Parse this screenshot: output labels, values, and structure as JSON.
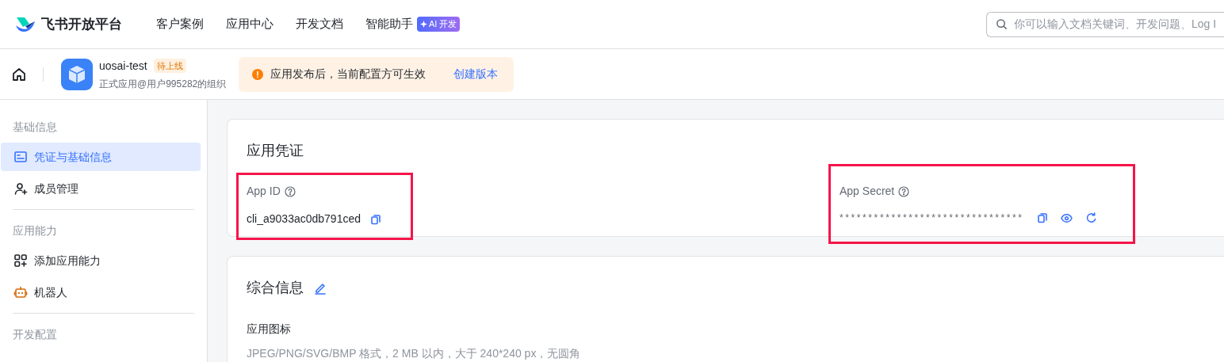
{
  "top_nav": {
    "logo_text": "飞书开放平台",
    "links": [
      {
        "label": "客户案例"
      },
      {
        "label": "应用中心"
      },
      {
        "label": "开发文档"
      },
      {
        "label": "智能助手",
        "badge": "AI 开发"
      }
    ],
    "search": {
      "placeholder": "你可以输入文档关键词、开发问题、Log I"
    }
  },
  "app_bar": {
    "name": "uosai-test",
    "status": "待上线",
    "subtitle": "正式应用@用户995282的组织",
    "notice": {
      "text": "应用发布后，当前配置方可生效",
      "action": "创建版本"
    }
  },
  "sidebar": {
    "groups": [
      {
        "title": "基础信息",
        "items": [
          {
            "label": "凭证与基础信息",
            "selected": true
          },
          {
            "label": "成员管理",
            "selected": false
          }
        ]
      },
      {
        "title": "应用能力",
        "items": [
          {
            "label": "添加应用能力",
            "selected": false
          },
          {
            "label": "机器人",
            "selected": false
          }
        ]
      },
      {
        "title": "开发配置"
      }
    ]
  },
  "credentials": {
    "title": "应用凭证",
    "app_id": {
      "label": "App ID",
      "value": "cli_a9033ac0db791ced"
    },
    "app_secret": {
      "label": "App Secret",
      "value": "********************************"
    }
  },
  "general": {
    "title": "综合信息",
    "icon_label": "应用图标",
    "icon_hint": "JPEG/PNG/SVG/BMP 格式，2 MB 以内，大于 240*240 px，无圆角"
  }
}
